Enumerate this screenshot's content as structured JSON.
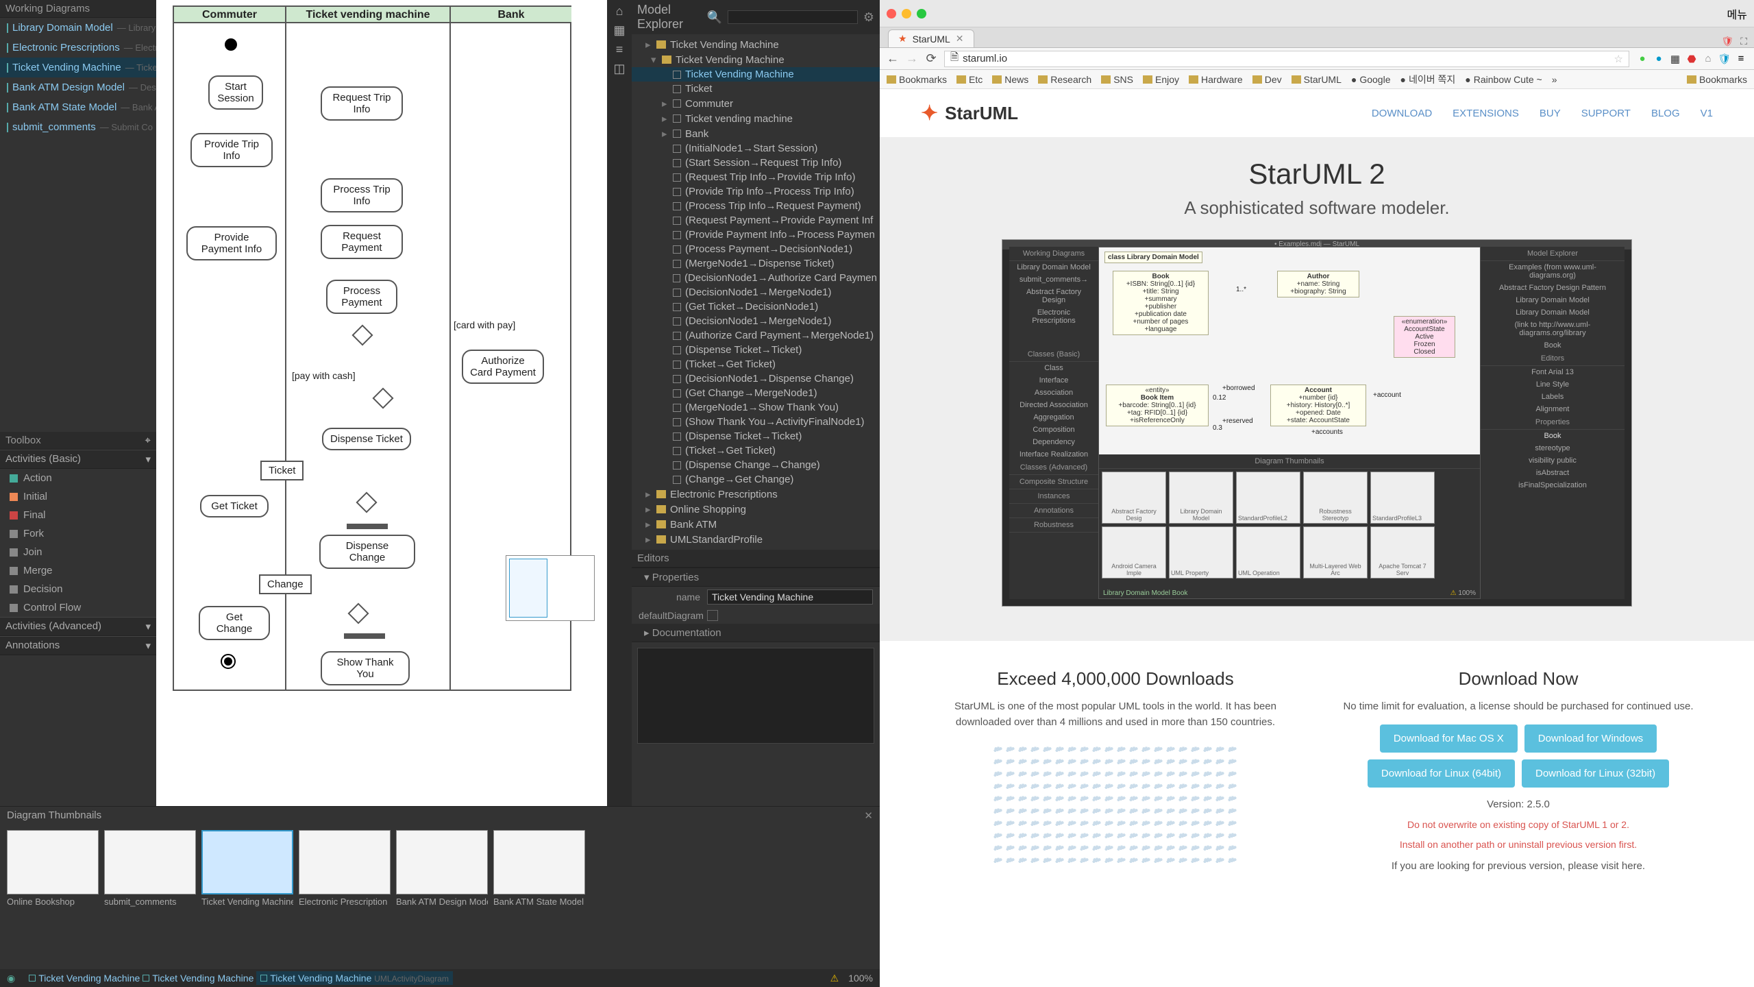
{
  "leftApp": {
    "workingDiagrams": {
      "title": "Working Diagrams",
      "items": [
        {
          "name": "Library Domain Model",
          "sub": "— Library D"
        },
        {
          "name": "Electronic Prescriptions",
          "sub": "— Electroni"
        },
        {
          "name": "Ticket Vending Machine",
          "sub": "— Ticket Ve",
          "selected": true
        },
        {
          "name": "Bank ATM Design Model",
          "sub": "— Design I"
        },
        {
          "name": "Bank ATM State Model",
          "sub": "— Bank ATM"
        },
        {
          "name": "submit_comments",
          "sub": "— Submit Co"
        }
      ]
    },
    "toolbox": {
      "title": "Toolbox",
      "sections": [
        {
          "label": "Activities (Basic)",
          "items": [
            "Action",
            "Initial",
            "Final",
            "Fork",
            "Join",
            "Merge",
            "Decision",
            "Control Flow"
          ]
        },
        {
          "label": "Activities (Advanced)",
          "items": []
        },
        {
          "label": "Annotations",
          "items": []
        }
      ]
    },
    "diagram": {
      "lanes": [
        "Commuter",
        "Ticket vending machine",
        "Bank"
      ],
      "nodes": {
        "start_session": "Start Session",
        "request_trip_info": "Request Trip Info",
        "provide_trip_info": "Provide Trip Info",
        "process_trip_info": "Process Trip Info",
        "provide_payment_info": "Provide Payment Info",
        "request_payment": "Request Payment",
        "process_payment": "Process Payment",
        "authorize_card_payment": "Authorize Card Payment",
        "dispense_ticket": "Dispense Ticket",
        "ticket": "Ticket",
        "get_ticket": "Get Ticket",
        "dispense_change": "Dispense Change",
        "change": "Change",
        "get_change": "Get Change",
        "show_thank_you": "Show Thank You"
      },
      "edge_labels": {
        "pay_cash": "[pay with cash]",
        "card_pay": "[card with pay]"
      }
    },
    "modelExplorer": {
      "title": "Model Explorer",
      "search_placeholder": "",
      "tree": [
        {
          "d": 0,
          "t": "▸",
          "icon": "folder",
          "label": "Ticket Vending Machine"
        },
        {
          "d": 1,
          "t": "▾",
          "icon": "folder",
          "label": "Ticket Vending Machine"
        },
        {
          "d": 2,
          "t": "",
          "icon": "doc",
          "label": "Ticket Vending Machine",
          "selected": true
        },
        {
          "d": 2,
          "t": "",
          "icon": "node",
          "label": "Ticket"
        },
        {
          "d": 2,
          "t": "▸",
          "icon": "node",
          "label": "Commuter"
        },
        {
          "d": 2,
          "t": "▸",
          "icon": "node",
          "label": "Ticket vending machine"
        },
        {
          "d": 2,
          "t": "▸",
          "icon": "node",
          "label": "Bank"
        },
        {
          "d": 2,
          "t": "",
          "icon": "node",
          "label": "(InitialNode1→Start Session)"
        },
        {
          "d": 2,
          "t": "",
          "icon": "node",
          "label": "(Start Session→Request Trip Info)"
        },
        {
          "d": 2,
          "t": "",
          "icon": "node",
          "label": "(Request Trip Info→Provide Trip Info)"
        },
        {
          "d": 2,
          "t": "",
          "icon": "node",
          "label": "(Provide Trip Info→Process Trip Info)"
        },
        {
          "d": 2,
          "t": "",
          "icon": "node",
          "label": "(Process Trip Info→Request Payment)"
        },
        {
          "d": 2,
          "t": "",
          "icon": "node",
          "label": "(Request Payment→Provide Payment Inf"
        },
        {
          "d": 2,
          "t": "",
          "icon": "node",
          "label": "(Provide Payment Info→Process Paymen"
        },
        {
          "d": 2,
          "t": "",
          "icon": "node",
          "label": "(Process Payment→DecisionNode1)"
        },
        {
          "d": 2,
          "t": "",
          "icon": "node",
          "label": "(MergeNode1→Dispense Ticket)"
        },
        {
          "d": 2,
          "t": "",
          "icon": "node",
          "label": "(DecisionNode1→Authorize Card Paymen"
        },
        {
          "d": 2,
          "t": "",
          "icon": "node",
          "label": "(DecisionNode1→MergeNode1)"
        },
        {
          "d": 2,
          "t": "",
          "icon": "node",
          "label": "(Get Ticket→DecisionNode1)"
        },
        {
          "d": 2,
          "t": "",
          "icon": "node",
          "label": "(DecisionNode1→MergeNode1)"
        },
        {
          "d": 2,
          "t": "",
          "icon": "node",
          "label": "(Authorize Card Payment→MergeNode1)"
        },
        {
          "d": 2,
          "t": "",
          "icon": "node",
          "label": "(Dispense Ticket→Ticket)"
        },
        {
          "d": 2,
          "t": "",
          "icon": "node",
          "label": "(Ticket→Get Ticket)"
        },
        {
          "d": 2,
          "t": "",
          "icon": "node",
          "label": "(DecisionNode1→Dispense Change)"
        },
        {
          "d": 2,
          "t": "",
          "icon": "node",
          "label": "(Get Change→MergeNode1)"
        },
        {
          "d": 2,
          "t": "",
          "icon": "node",
          "label": "(MergeNode1→Show Thank You)"
        },
        {
          "d": 2,
          "t": "",
          "icon": "node",
          "label": "(Show Thank You→ActivityFinalNode1)"
        },
        {
          "d": 2,
          "t": "",
          "icon": "node",
          "label": "(Dispense Ticket→Ticket)"
        },
        {
          "d": 2,
          "t": "",
          "icon": "node",
          "label": "(Ticket→Get Ticket)"
        },
        {
          "d": 2,
          "t": "",
          "icon": "node",
          "label": "(Dispense Change→Change)"
        },
        {
          "d": 2,
          "t": "",
          "icon": "node",
          "label": "(Change→Get Change)"
        },
        {
          "d": 0,
          "t": "▸",
          "icon": "folder",
          "label": "Electronic Prescriptions"
        },
        {
          "d": 0,
          "t": "▸",
          "icon": "folder",
          "label": "Online Shopping"
        },
        {
          "d": 0,
          "t": "▸",
          "icon": "folder",
          "label": "Bank ATM"
        },
        {
          "d": 0,
          "t": "▸",
          "icon": "folder",
          "label": "UMLStandardProfile"
        }
      ]
    },
    "editors_label": "Editors",
    "properties": {
      "title": "Properties",
      "name_label": "name",
      "name_value": "Ticket Vending Machine",
      "default_label": "defaultDiagram",
      "doc_title": "Documentation"
    },
    "thumbnails": {
      "title": "Diagram Thumbnails",
      "items": [
        {
          "label": "Online Bookshop"
        },
        {
          "label": "submit_comments"
        },
        {
          "label": "Ticket Vending Machine",
          "selected": true
        },
        {
          "label": "Electronic Prescription"
        },
        {
          "label": "Bank ATM Design Mode"
        },
        {
          "label": "Bank ATM State Model"
        }
      ]
    },
    "statusBar": {
      "tabs": [
        {
          "label": "Ticket Vending Machine"
        },
        {
          "label": "Ticket Vending Machine"
        },
        {
          "label": "Ticket Vending Machine",
          "sub": "UMLActivityDiagram",
          "selected": true
        }
      ],
      "zoom": "100%"
    }
  },
  "browser": {
    "tab_title": "StarUML",
    "menu_label": "메뉴",
    "url": "staruml.io",
    "bookmarks_label": "Bookmarks",
    "bookmarks": [
      "Bookmarks",
      "Etc",
      "News",
      "Research",
      "SNS",
      "Enjoy",
      "Hardware",
      "Dev",
      "StarUML",
      "Google",
      "네이버 쪽지",
      "Rainbow Cute ~"
    ],
    "bookmarks_right": "Bookmarks",
    "site": {
      "brand": "StarUML",
      "nav": [
        "DOWNLOAD",
        "EXTENSIONS",
        "BUY",
        "SUPPORT",
        "BLOG",
        "V1"
      ],
      "hero_title": "StarUML 2",
      "hero_sub": "A sophisticated software modeler.",
      "screenshot": {
        "title": "• Examples.mdj — StarUML",
        "wd": "Working Diagrams",
        "wd_items": [
          "Library Domain Model",
          "submit_comments→",
          "Abstract Factory Design",
          "Electronic Prescriptions"
        ],
        "toolbox": "Classes (Basic)",
        "tb_items": [
          "Class",
          "Interface",
          "Association",
          "Directed Association",
          "Aggregation",
          "Composition",
          "Dependency",
          "Interface Realization"
        ],
        "tb2": "Classes (Advanced)",
        "tb3": "Instances",
        "tb4": "Annotations",
        "tb5": "Composite Structure",
        "tb6": "Robustness",
        "canvas_title": "class Library Domain Model",
        "boxes": {
          "book": "Book",
          "book_attrs": "+ISBN: String[0..1] {id}\n+title: String\n+summary\n+publisher\n+publication date\n+number of pages\n+language",
          "author": "Author",
          "author_attrs": "+name: String\n+biography: String",
          "enum": "«enumeration»\nAccountState",
          "enum_vals": "Active\nFrozen\nClosed",
          "bookitem": "Book Item",
          "bookitem_attrs": "+barcode: String[0..1] {id}\n+tag: RFID[0..1] {id}\n+isReferenceOnly",
          "account": "Account",
          "account_attrs": "+number {id}\n+history: History[0..*]\n+opened: Date\n+state: AccountState",
          "entity": "«entity»",
          "borrowed": "+borrowed",
          "reserved": "+reserved",
          "account_rel": "+account",
          "accounts_rel": "+accounts",
          "mult1": "1..*",
          "mult2": "0.12",
          "mult3": "0.3"
        },
        "me": "Model Explorer",
        "me_items": [
          "Examples (from www.uml-diagrams.org)",
          "Abstract Factory Design Pattern",
          "Library Domain Model",
          "Library Domain Model",
          "(link to http://www.uml-diagrams.org/library",
          "Book"
        ],
        "editors": "Editors",
        "ed_font": "Font  Arial  13",
        "ed_line": "Line Style",
        "ed_label": "Labels",
        "ed_align": "Alignment",
        "props": "Properties",
        "props_name": "Book",
        "props_items": [
          "stereotype",
          "visibility  public",
          "isAbstract",
          "isFinalSpecialization"
        ],
        "thumbs_title": "Diagram Thumbnails",
        "thumbs": [
          "Abstract Factory Desig",
          "Library Domain Model",
          "StandardProfileL2",
          "Robustness Stereotyp",
          "StandardProfileL3",
          "Android Camera Imple",
          "UML Property",
          "UML Operation",
          "Multi-Layered Web Arc",
          "Apache Tomcat 7 Serv"
        ],
        "status": "Library Domain Model   Book",
        "zoom": "100%"
      },
      "col1_title": "Exceed 4,000,000 Downloads",
      "col1_text": "StarUML is one of the most popular UML tools in the world. It has been downloaded over than 4 millions and used in more than 150 countries.",
      "col2_title": "Download Now",
      "col2_text": "No time limit for evaluation, a license should be purchased for continued use.",
      "dl_buttons": [
        "Download for Mac OS X",
        "Download for Windows",
        "Download for Linux (64bit)",
        "Download for Linux (32bit)"
      ],
      "version": "Version: 2.5.0",
      "warn1": "Do not overwrite on existing copy of StarUML 1 or 2.",
      "warn2": "Install on another path or uninstall previous version first.",
      "prev": "If you are looking for previous version, please visit here."
    }
  }
}
